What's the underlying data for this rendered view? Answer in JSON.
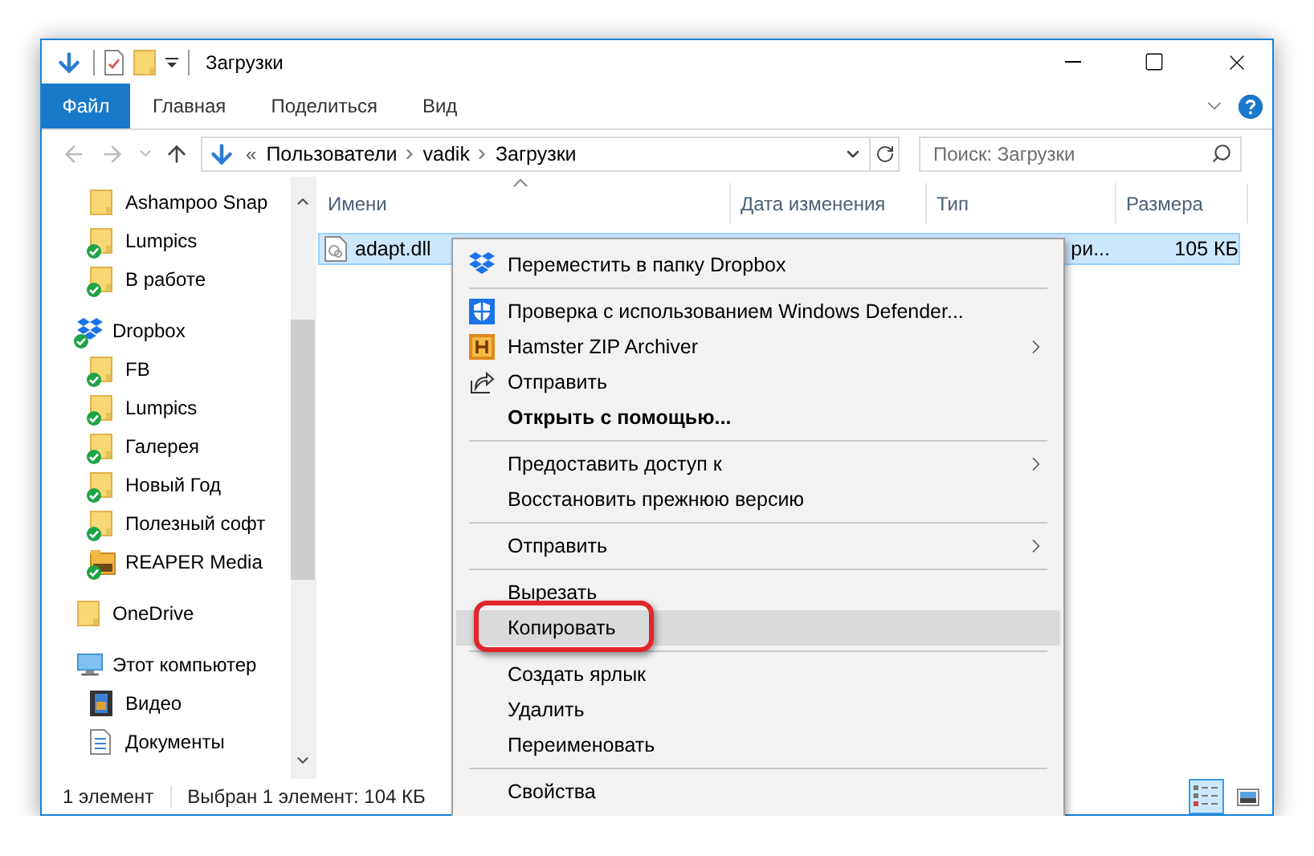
{
  "window": {
    "title": "Загрузки"
  },
  "ribbon": {
    "tabs": [
      {
        "label": "Файл",
        "selected": true
      },
      {
        "label": "Главная",
        "selected": false
      },
      {
        "label": "Поделиться",
        "selected": false
      },
      {
        "label": "Вид",
        "selected": false
      }
    ]
  },
  "address": {
    "overflow": "«",
    "path": [
      "Пользователи",
      "vadik",
      "Загрузки"
    ]
  },
  "search": {
    "placeholder": "Поиск: Загрузки"
  },
  "navigation": {
    "continued_items": [
      {
        "label": "Ashampoo Snap",
        "kind": "folder",
        "synced": false
      },
      {
        "label": "Lumpics",
        "kind": "folder",
        "synced": true
      },
      {
        "label": "В работе",
        "kind": "folder",
        "synced": true
      }
    ],
    "items": [
      {
        "label": "Dropbox",
        "kind": "dropbox",
        "synced": true,
        "children": [
          {
            "label": "FB",
            "kind": "folder",
            "synced": true
          },
          {
            "label": "Lumpics",
            "kind": "folder",
            "synced": true
          },
          {
            "label": "Галерея",
            "kind": "folder",
            "synced": true
          },
          {
            "label": "Новый Год",
            "kind": "folder",
            "synced": true
          },
          {
            "label": "Полезный софт",
            "kind": "folder",
            "synced": true
          },
          {
            "label": "REAPER Media",
            "kind": "archive",
            "synced": true
          }
        ]
      },
      {
        "label": "OneDrive",
        "kind": "folder",
        "synced": false
      },
      {
        "label": "Этот компьютер",
        "kind": "computer",
        "synced": false,
        "children": [
          {
            "label": "Видео",
            "kind": "video",
            "synced": false
          },
          {
            "label": "Документы",
            "kind": "documents",
            "synced": false
          }
        ]
      }
    ]
  },
  "table": {
    "columns": [
      "Имени",
      "Дата изменения",
      "Тип",
      "Размера"
    ],
    "rows": [
      {
        "name": "adapt.dll",
        "type": "ри...",
        "size": "105 КБ",
        "selected": true
      }
    ]
  },
  "context_menu": {
    "items": [
      {
        "kind": "dropbox",
        "label": "Переместить в папку Dropbox",
        "bold": false,
        "submenu": false,
        "selected": false,
        "outlined": false
      },
      {
        "kind": "separator"
      },
      {
        "kind": "shield",
        "label": "Проверка с использованием Windows Defender...",
        "bold": false,
        "submenu": false,
        "selected": false,
        "outlined": false
      },
      {
        "kind": "hamster",
        "label": "Hamster ZIP Archiver",
        "bold": false,
        "submenu": true,
        "selected": false,
        "outlined": false
      },
      {
        "kind": "share",
        "label": "Отправить",
        "bold": false,
        "submenu": false,
        "selected": false,
        "outlined": false
      },
      {
        "kind": "item",
        "label": "Открыть с помощью...",
        "bold": true,
        "submenu": false,
        "selected": false,
        "outlined": false
      },
      {
        "kind": "separator"
      },
      {
        "kind": "item",
        "label": "Предоставить доступ к",
        "bold": false,
        "submenu": true,
        "selected": false,
        "outlined": false
      },
      {
        "kind": "item",
        "label": "Восстановить прежнюю версию",
        "bold": false,
        "submenu": false,
        "selected": false,
        "outlined": false
      },
      {
        "kind": "separator"
      },
      {
        "kind": "item",
        "label": "Отправить",
        "bold": false,
        "submenu": true,
        "selected": false,
        "outlined": false
      },
      {
        "kind": "separator"
      },
      {
        "kind": "item",
        "label": "Вырезать",
        "bold": false,
        "submenu": false,
        "selected": false,
        "outlined": false
      },
      {
        "kind": "item",
        "label": "Копировать",
        "bold": false,
        "submenu": false,
        "selected": true,
        "outlined": true
      },
      {
        "kind": "separator"
      },
      {
        "kind": "item",
        "label": "Создать ярлык",
        "bold": false,
        "submenu": false,
        "selected": false,
        "outlined": false
      },
      {
        "kind": "item",
        "label": "Удалить",
        "bold": false,
        "submenu": false,
        "selected": false,
        "outlined": false
      },
      {
        "kind": "item",
        "label": "Переименовать",
        "bold": false,
        "submenu": false,
        "selected": false,
        "outlined": false
      },
      {
        "kind": "separator"
      },
      {
        "kind": "item",
        "label": "Свойства",
        "bold": false,
        "submenu": false,
        "selected": false,
        "outlined": false
      }
    ]
  },
  "status_bar": {
    "item_count": "1 элемент",
    "selection": "Выбран 1 элемент: 104 КБ",
    "views": [
      {
        "kind": "details",
        "selected": true
      },
      {
        "kind": "large_icons",
        "selected": false
      }
    ]
  }
}
